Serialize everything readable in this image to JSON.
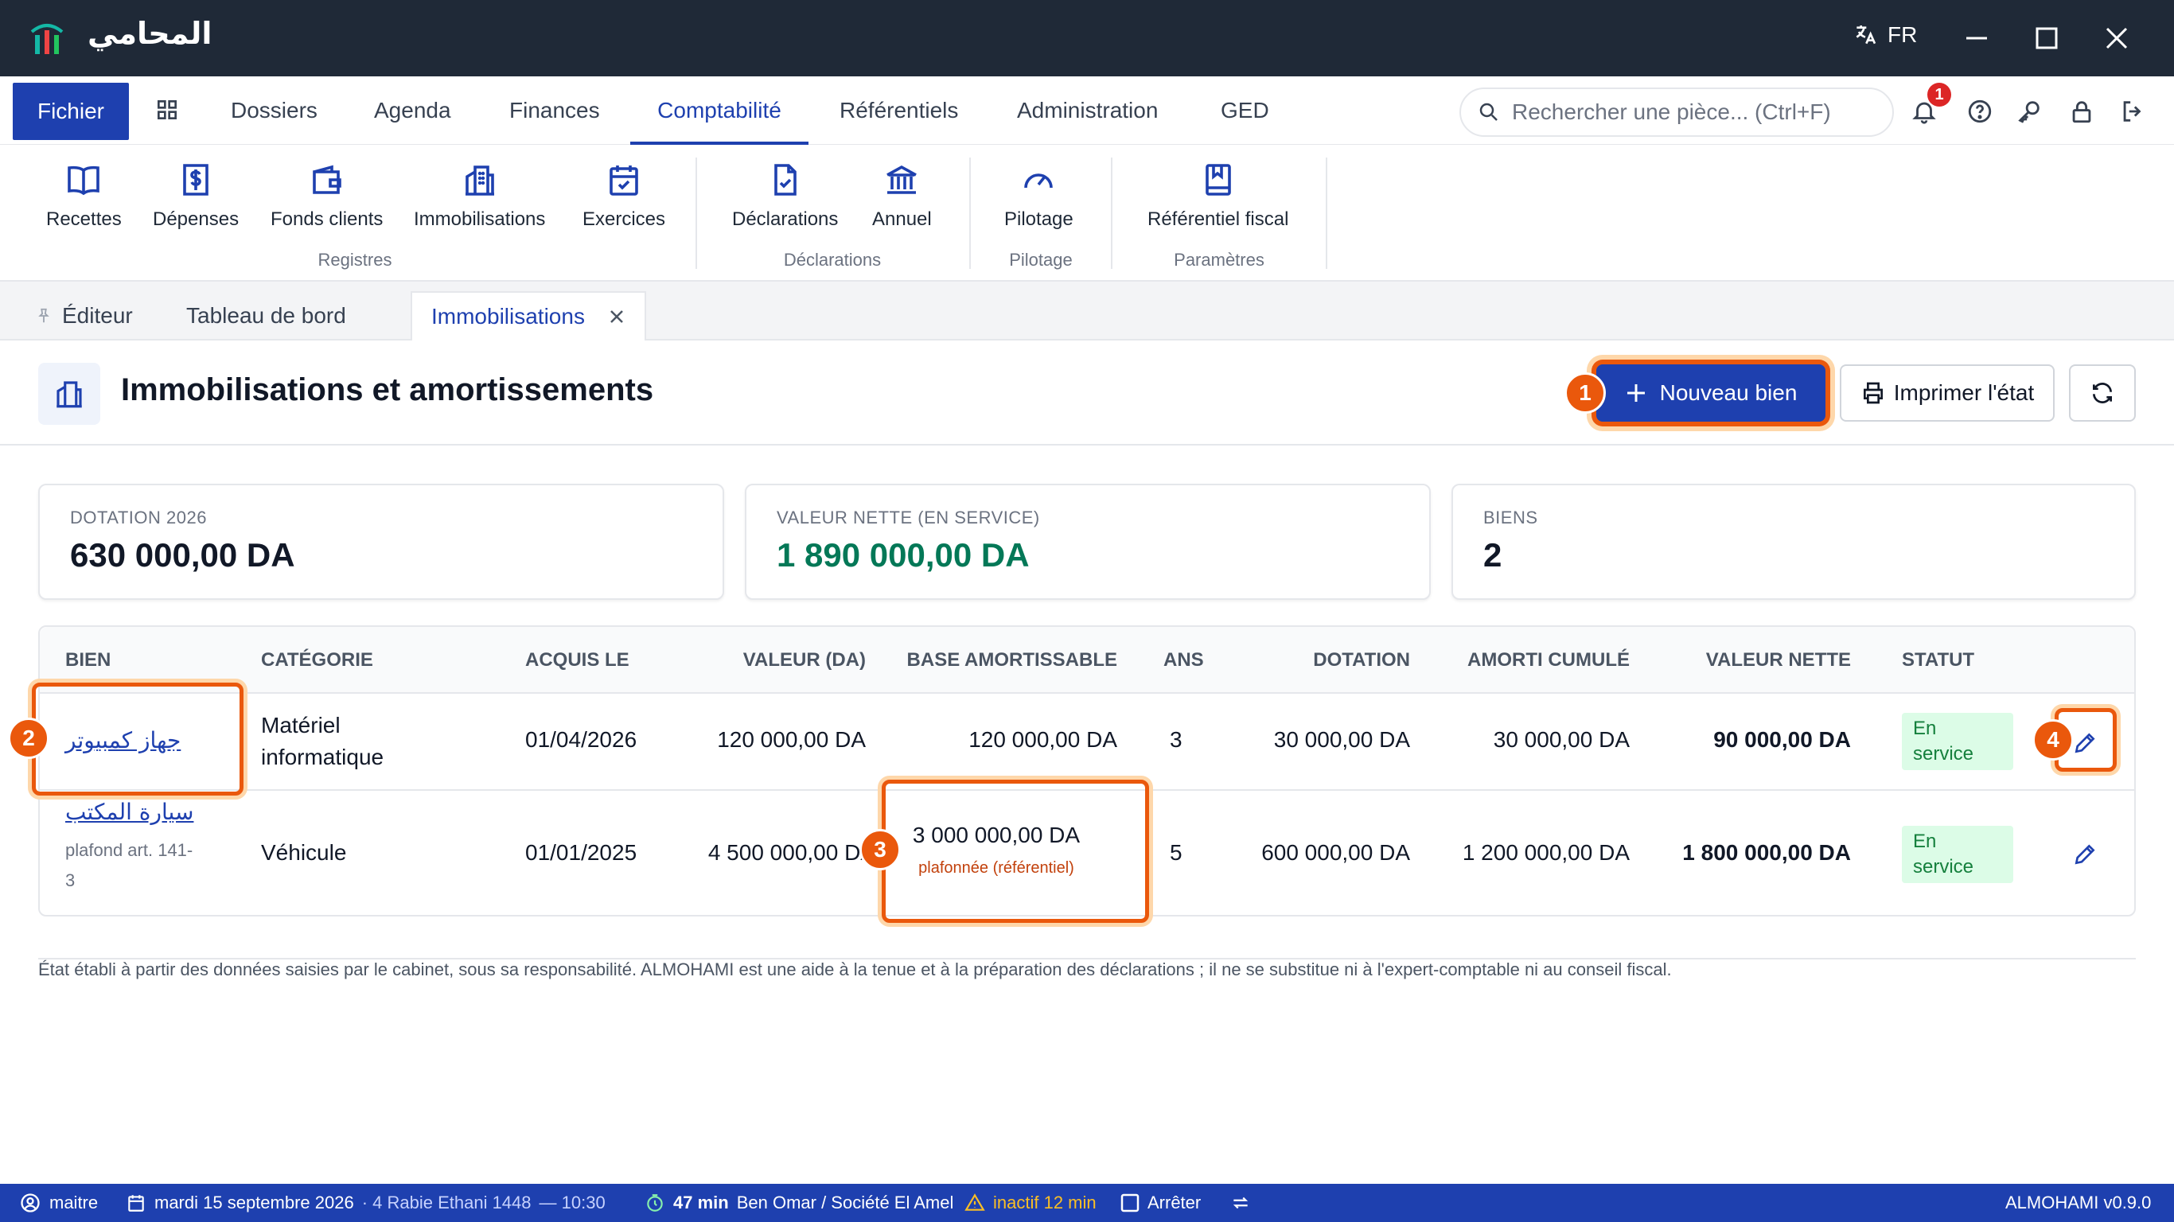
{
  "app": {
    "logo_text": "المحامي",
    "lang": "FR",
    "version": "ALMOHAMI v0.9.0"
  },
  "menu": {
    "fichier": "Fichier",
    "items": [
      "Dossiers",
      "Agenda",
      "Finances",
      "Comptabilité",
      "Référentiels",
      "Administration",
      "GED"
    ],
    "active": "Comptabilité",
    "search_placeholder": "Rechercher une pièce... (Ctrl+F)",
    "notification_count": "1"
  },
  "ribbon": {
    "buttons": [
      "Recettes",
      "Dépenses",
      "Fonds clients",
      "Immobilisations",
      "Exercices",
      "Déclarations",
      "Annuel",
      "Pilotage",
      "Référentiel fiscal"
    ],
    "groups": [
      "Registres",
      "Déclarations",
      "Pilotage",
      "Paramètres"
    ]
  },
  "tabs": [
    "Éditeur",
    "Tableau de bord",
    "Immobilisations"
  ],
  "page": {
    "title": "Immobilisations et amortissements",
    "new_button": "Nouveau bien",
    "print_button": "Imprimer l'état"
  },
  "cards": [
    {
      "label": "DOTATION 2026",
      "value": "630 000,00 DA"
    },
    {
      "label": "VALEUR NETTE (EN SERVICE)",
      "value": "1 890 000,00 DA"
    },
    {
      "label": "BIENS",
      "value": "2"
    }
  ],
  "table": {
    "headers": [
      "BIEN",
      "CATÉGORIE",
      "ACQUIS LE",
      "VALEUR (DA)",
      "BASE AMORTISSABLE",
      "ANS",
      "DOTATION",
      "AMORTI CUMULÉ",
      "VALEUR NETTE",
      "STATUT"
    ],
    "rows": [
      {
        "bien": "جهاز كمبيوتر",
        "bien_note": "",
        "categorie_l1": "Matériel",
        "categorie_l2": "informatique",
        "acquis": "01/04/2026",
        "valeur": "120 000,00 DA",
        "base": "120 000,00 DA",
        "base_note": "",
        "ans": "3",
        "dotation": "30 000,00 DA",
        "amorti": "30 000,00 DA",
        "nette": "90 000,00 DA",
        "statut_l1": "En",
        "statut_l2": "service"
      },
      {
        "bien": "سيارة المكتب",
        "bien_note_l1": "plafond art. 141-",
        "bien_note_l2": "3",
        "categorie_l1": "Véhicule",
        "categorie_l2": "",
        "acquis": "01/01/2025",
        "valeur": "4 500 000,00 DA",
        "base": "3 000 000,00 DA",
        "base_note": "plafonnée (référentiel)",
        "ans": "5",
        "dotation": "600 000,00 DA",
        "amorti": "1 200 000,00 DA",
        "nette": "1 800 000,00 DA",
        "statut_l1": "En",
        "statut_l2": "service"
      }
    ]
  },
  "callouts": [
    "1",
    "2",
    "3",
    "4"
  ],
  "note": "État établi à partir des données saisies par le cabinet, sous sa responsabilité. ALMOHAMI est une aide à la tenue et à la préparation des déclarations ; il ne se substitue ni à l'expert-comptable ni au conseil fiscal.",
  "statusbar": {
    "user": "maitre",
    "date": "mardi 15 septembre 2026",
    "hijri": "· 4 Rabie Ethani 1448",
    "time": "— 10:30",
    "timer": "47 min",
    "client": "Ben Omar / Société El Amel",
    "inactive": "inactif 12 min",
    "stop": "Arrêter"
  },
  "colors": {
    "primary": "#1e40af",
    "accent": "#ea580c",
    "green": "#047857",
    "dark": "#1f2937"
  }
}
